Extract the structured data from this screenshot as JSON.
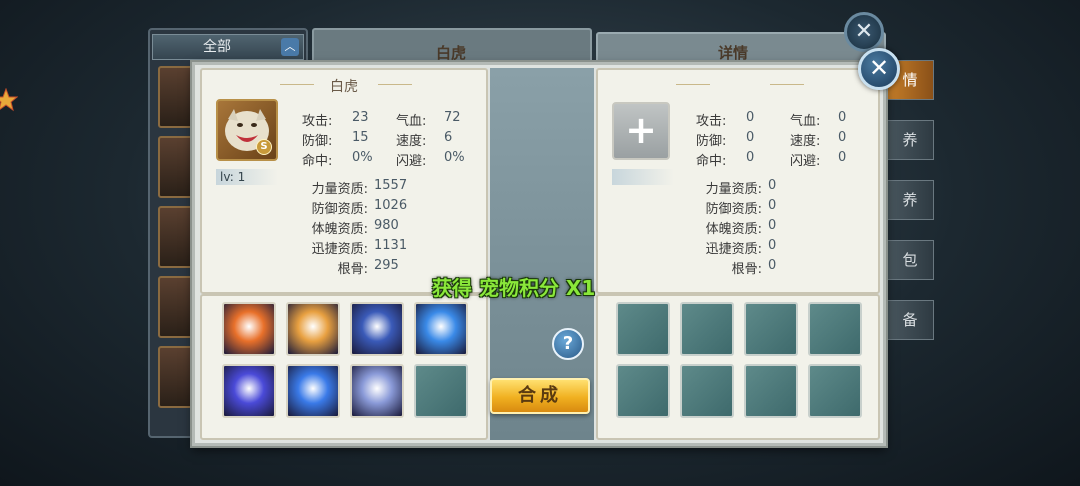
{
  "background": {
    "filter_label": "全部",
    "filter_arrow": "︿",
    "mid_title": "白虎",
    "right_title": "详情",
    "tabs": [
      "情",
      "养",
      "养",
      "包",
      "备"
    ],
    "close_icon": "✕"
  },
  "dialog": {
    "close_icon": "✕",
    "left_card": {
      "title": "白虎",
      "rank": "S",
      "level": "lv: 1",
      "stats": {
        "attack_label": "攻击:",
        "attack": "23",
        "hp_label": "气血:",
        "hp": "72",
        "defense_label": "防御:",
        "defense": "15",
        "speed_label": "速度:",
        "speed": "6",
        "hit_label": "命中:",
        "hit": "0%",
        "dodge_label": "闪避:",
        "dodge": "0%"
      },
      "aptitudes": [
        {
          "label": "力量资质:",
          "value": "1557"
        },
        {
          "label": "防御资质:",
          "value": "1026"
        },
        {
          "label": "体魄资质:",
          "value": "980"
        },
        {
          "label": "迅捷资质:",
          "value": "1131"
        },
        {
          "label": "根骨:",
          "value": "295"
        }
      ],
      "skills": [
        {
          "name": "phoenix-skill-icon",
          "color": "#e8702a"
        },
        {
          "name": "tiger-skill-icon",
          "color": "#e8a040"
        },
        {
          "name": "claw-skill-icon",
          "color": "#3a5ab8"
        },
        {
          "name": "heart-skill-icon",
          "color": "#3a8ae8"
        },
        {
          "name": "orb-skill-icon",
          "color": "#4a4ad8"
        },
        {
          "name": "lightning-skill-icon",
          "color": "#3a7ae8"
        },
        {
          "name": "sphere-skill-icon",
          "color": "#8a9ad8"
        },
        {
          "name": "empty-slot",
          "color": ""
        }
      ]
    },
    "right_card": {
      "add_icon": "+",
      "stats": {
        "attack_label": "攻击:",
        "attack": "0",
        "hp_label": "气血:",
        "hp": "0",
        "defense_label": "防御:",
        "defense": "0",
        "speed_label": "速度:",
        "speed": "0",
        "hit_label": "命中:",
        "hit": "0",
        "dodge_label": "闪避:",
        "dodge": "0"
      },
      "aptitudes": [
        {
          "label": "力量资质:",
          "value": "0"
        },
        {
          "label": "防御资质:",
          "value": "0"
        },
        {
          "label": "体魄资质:",
          "value": "0"
        },
        {
          "label": "迅捷资质:",
          "value": "0"
        },
        {
          "label": "根骨:",
          "value": "0"
        }
      ]
    },
    "help_icon": "?",
    "merge_label": "合成",
    "toast": "获得 宠物积分 X1"
  }
}
